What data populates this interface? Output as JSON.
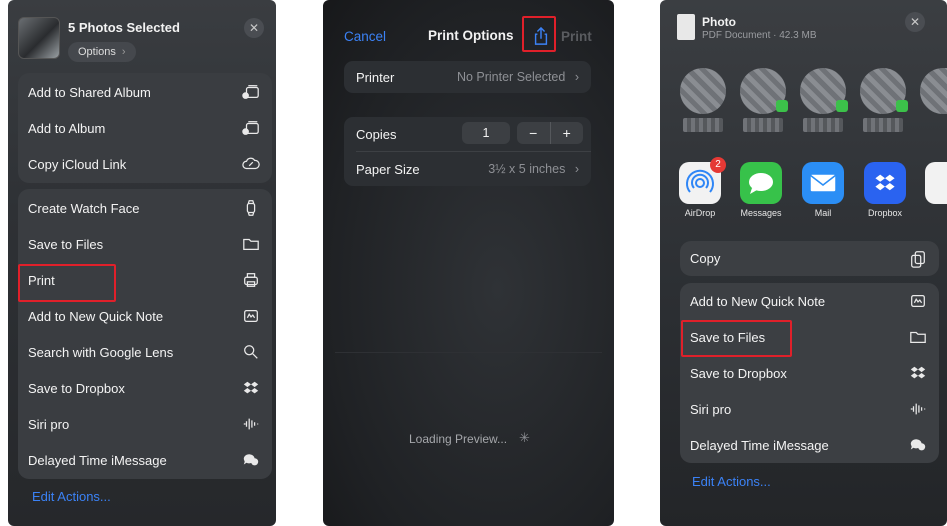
{
  "panel1": {
    "header": {
      "title": "5 Photos Selected",
      "options_label": "Options",
      "close": "✕"
    },
    "group1": [
      "Add to Shared Album",
      "Add to Album",
      "Copy iCloud Link"
    ],
    "group2": [
      "Create Watch Face",
      "Save to Files",
      "Print",
      "Add to New Quick Note",
      "Search with Google Lens",
      "Save to Dropbox",
      "Siri pro",
      "Delayed Time iMessage"
    ],
    "edit_actions": "Edit Actions..."
  },
  "panel2": {
    "cancel": "Cancel",
    "title": "Print Options",
    "print": "Print",
    "printer_label": "Printer",
    "printer_value": "No Printer Selected",
    "copies_label": "Copies",
    "copies_value": "1",
    "minus": "−",
    "plus": "+",
    "paper_label": "Paper Size",
    "paper_value": "3½ x 5 inches",
    "loading": "Loading Preview..."
  },
  "panel3": {
    "header": {
      "title": "Photo",
      "subtitle": "PDF Document · 42.3 MB",
      "close": "✕"
    },
    "apps": [
      {
        "label": "AirDrop",
        "badge": "2"
      },
      {
        "label": "Messages"
      },
      {
        "label": "Mail"
      },
      {
        "label": "Dropbox"
      }
    ],
    "copy": "Copy",
    "actions": [
      "Add to New Quick Note",
      "Save to Files",
      "Save to Dropbox",
      "Siri pro",
      "Delayed Time iMessage"
    ],
    "edit_actions": "Edit Actions..."
  },
  "colors": {
    "highlight": "#e0202a",
    "link": "#3b82f6",
    "accent_share": "#3b82f6"
  }
}
